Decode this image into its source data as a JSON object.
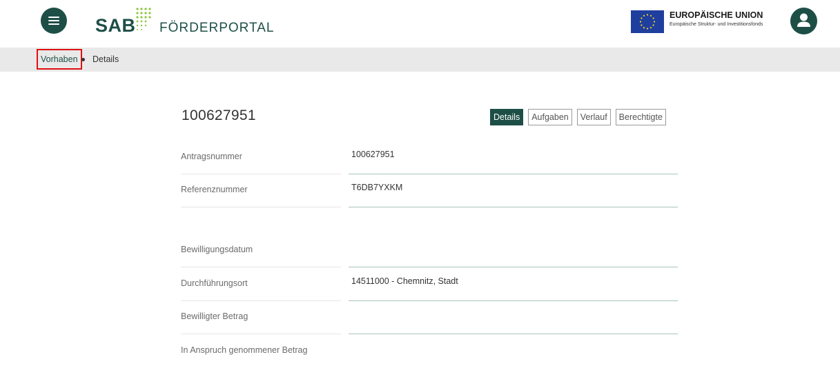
{
  "header": {
    "logo_brand": "SAB",
    "logo_text": "FÖRDERPORTAL",
    "eu_title": "EUROPÄISCHE UNION",
    "eu_subtitle": "Europäische Struktur- und Investitionsfonds",
    "brand_color": "#1d4f46"
  },
  "breadcrumb": {
    "link_label": "Vorhaben",
    "current_label": "Details"
  },
  "main": {
    "title": "100627951",
    "tabs": [
      {
        "label": "Details",
        "active": true
      },
      {
        "label": "Aufgaben",
        "active": false
      },
      {
        "label": "Verlauf",
        "active": false
      },
      {
        "label": "Berechtigte",
        "active": false
      }
    ],
    "fields": [
      {
        "label": "Antragsnummer",
        "value": "100627951"
      },
      {
        "label": "Referenznummer",
        "value": "T6DB7YXKM"
      },
      {
        "label": "Bewilligungsdatum",
        "value": ""
      },
      {
        "label": "Durchführungsort",
        "value": "14511000 - Chemnitz, Stadt"
      },
      {
        "label": "Bewilligter Betrag",
        "value": ""
      },
      {
        "label": "In Anspruch genommener Betrag",
        "value": ""
      }
    ]
  }
}
